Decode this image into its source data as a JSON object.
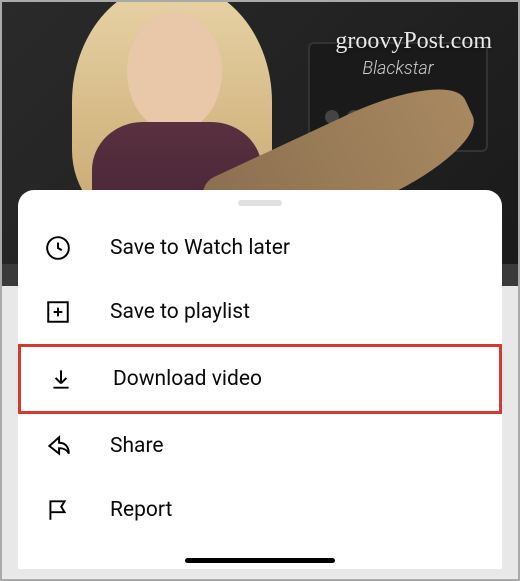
{
  "watermark": "groovyPost.com",
  "amp_label": "Blackstar",
  "menu": {
    "items": [
      {
        "label": "Save to Watch later"
      },
      {
        "label": "Save to playlist"
      },
      {
        "label": "Download video"
      },
      {
        "label": "Share"
      },
      {
        "label": "Report"
      }
    ]
  }
}
